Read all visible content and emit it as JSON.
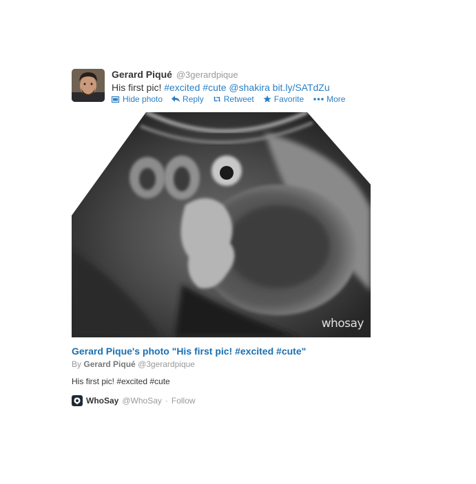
{
  "tweet": {
    "author_name": "Gerard Piqué",
    "author_handle": "@3gerardpique",
    "text_plain": "His first pic!",
    "hashtags": [
      "#excited",
      "#cute"
    ],
    "mention": "@shakira",
    "url": "bit.ly/SATdZu",
    "actions": {
      "hide_photo": "Hide photo",
      "reply": "Reply",
      "retweet": "Retweet",
      "favorite": "Favorite",
      "more": "More"
    },
    "link_color": "#2a7fc5"
  },
  "media": {
    "watermark": "whosay"
  },
  "card": {
    "title": "Gerard Pique's photo \"His first pic! #excited #cute\"",
    "by_prefix": "By",
    "by_name": "Gerard Piqué",
    "by_handle": "@3gerardpique",
    "description": "His first pic! #excited #cute",
    "title_color": "#1a6fb0"
  },
  "source": {
    "name": "WhoSay",
    "handle": "@WhoSay",
    "separator": "·",
    "follow": "Follow"
  }
}
